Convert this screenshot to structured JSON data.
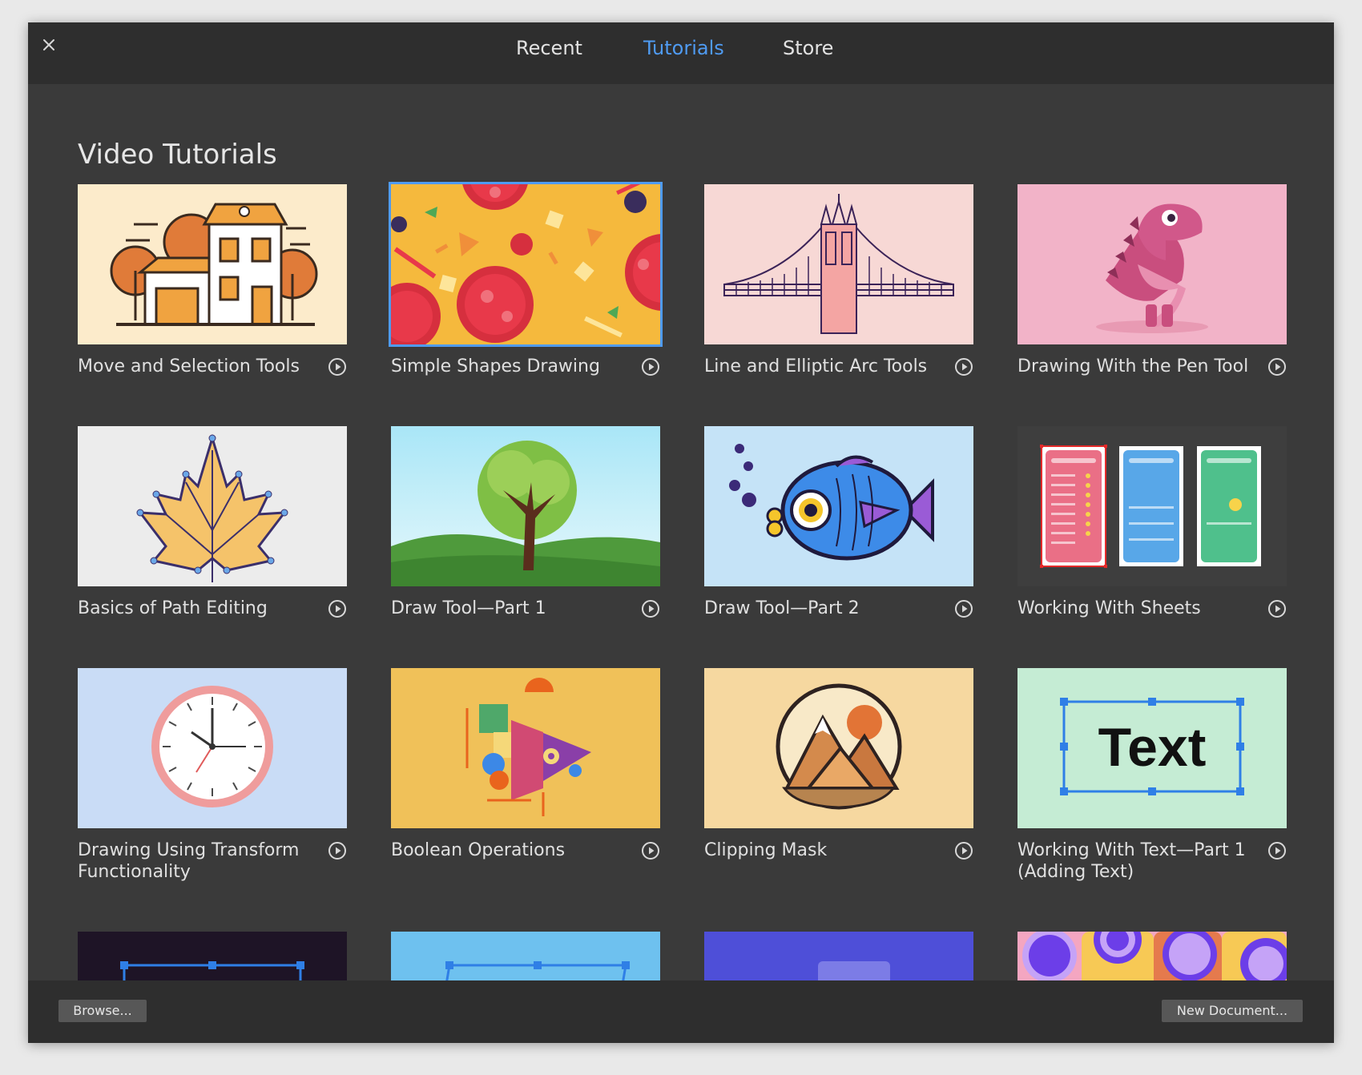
{
  "tabs": [
    {
      "label": "Recent",
      "active": false
    },
    {
      "label": "Tutorials",
      "active": true
    },
    {
      "label": "Store",
      "active": false
    }
  ],
  "section_title": "Video Tutorials",
  "tutorials": [
    {
      "title": "Move and Selection Tools",
      "icon": "play-icon"
    },
    {
      "title": "Simple Shapes Drawing",
      "icon": "play-icon",
      "selected": true
    },
    {
      "title": "Line and Elliptic Arc Tools",
      "icon": "play-icon"
    },
    {
      "title": "Drawing With the Pen Tool",
      "icon": "play-icon"
    },
    {
      "title": "Basics of Path Editing",
      "icon": "play-icon"
    },
    {
      "title": "Draw Tool—Part 1",
      "icon": "play-icon"
    },
    {
      "title": "Draw Tool—Part 2",
      "icon": "play-icon"
    },
    {
      "title": "Working With Sheets",
      "icon": "play-icon"
    },
    {
      "title": "Drawing Using Transform Functionality",
      "icon": "play-icon"
    },
    {
      "title": "Boolean Operations",
      "icon": "play-icon"
    },
    {
      "title": "Clipping Mask",
      "icon": "play-icon"
    },
    {
      "title": "Working With Text—Part 1 (Adding Text)",
      "icon": "play-icon"
    }
  ],
  "thumbnail_text": "Text",
  "footer": {
    "browse_label": "Browse...",
    "new_document_label": "New Document..."
  },
  "colors": {
    "window_bg": "#3a3a3a",
    "bar_bg": "#2e2e2e",
    "accent": "#4f9bf2"
  }
}
